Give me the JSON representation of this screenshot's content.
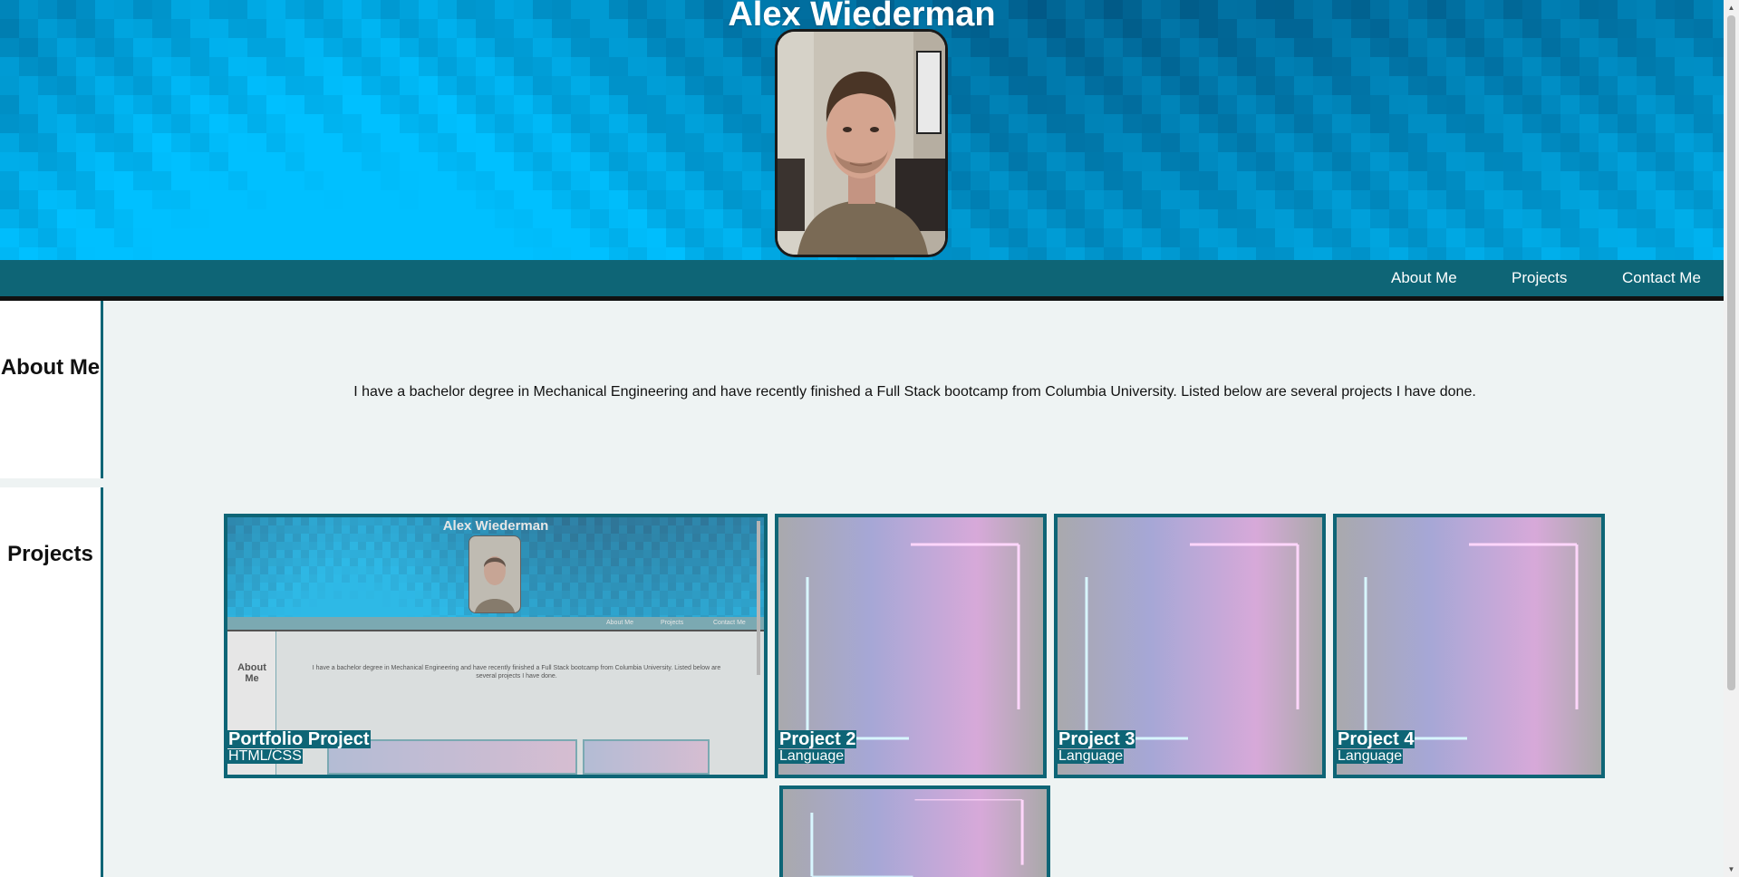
{
  "header": {
    "name": "Alex Wiederman"
  },
  "nav": {
    "items": [
      {
        "label": "About Me"
      },
      {
        "label": "Projects"
      },
      {
        "label": "Contact Me"
      }
    ]
  },
  "about": {
    "heading": "About Me",
    "text": "I have a bachelor degree in Mechanical Engineering and have recently finished a Full Stack bootcamp from Columbia University. Listed below are several projects I have done."
  },
  "projects": {
    "heading": "Projects",
    "cards": [
      {
        "title": "Portfolio Project",
        "language": "HTML/CSS"
      },
      {
        "title": "Project 2",
        "language": "Language"
      },
      {
        "title": "Project 3",
        "language": "Language"
      },
      {
        "title": "Project 4",
        "language": "Language"
      },
      {
        "title": "",
        "language": ""
      }
    ]
  },
  "thumbnail": {
    "name": "Alex Wiederman",
    "nav": [
      "About Me",
      "Projects",
      "Contact Me"
    ],
    "about_heading": "About Me",
    "about_text": "I have a bachelor degree in Mechanical Engineering and have recently finished a Full Stack bootcamp from Columbia University. Listed below are several projects I have done."
  },
  "colors": {
    "accent": "#0e6576",
    "header_dark": "#013056",
    "header_light": "#00c0ff",
    "page_bg": "#eef3f3"
  }
}
